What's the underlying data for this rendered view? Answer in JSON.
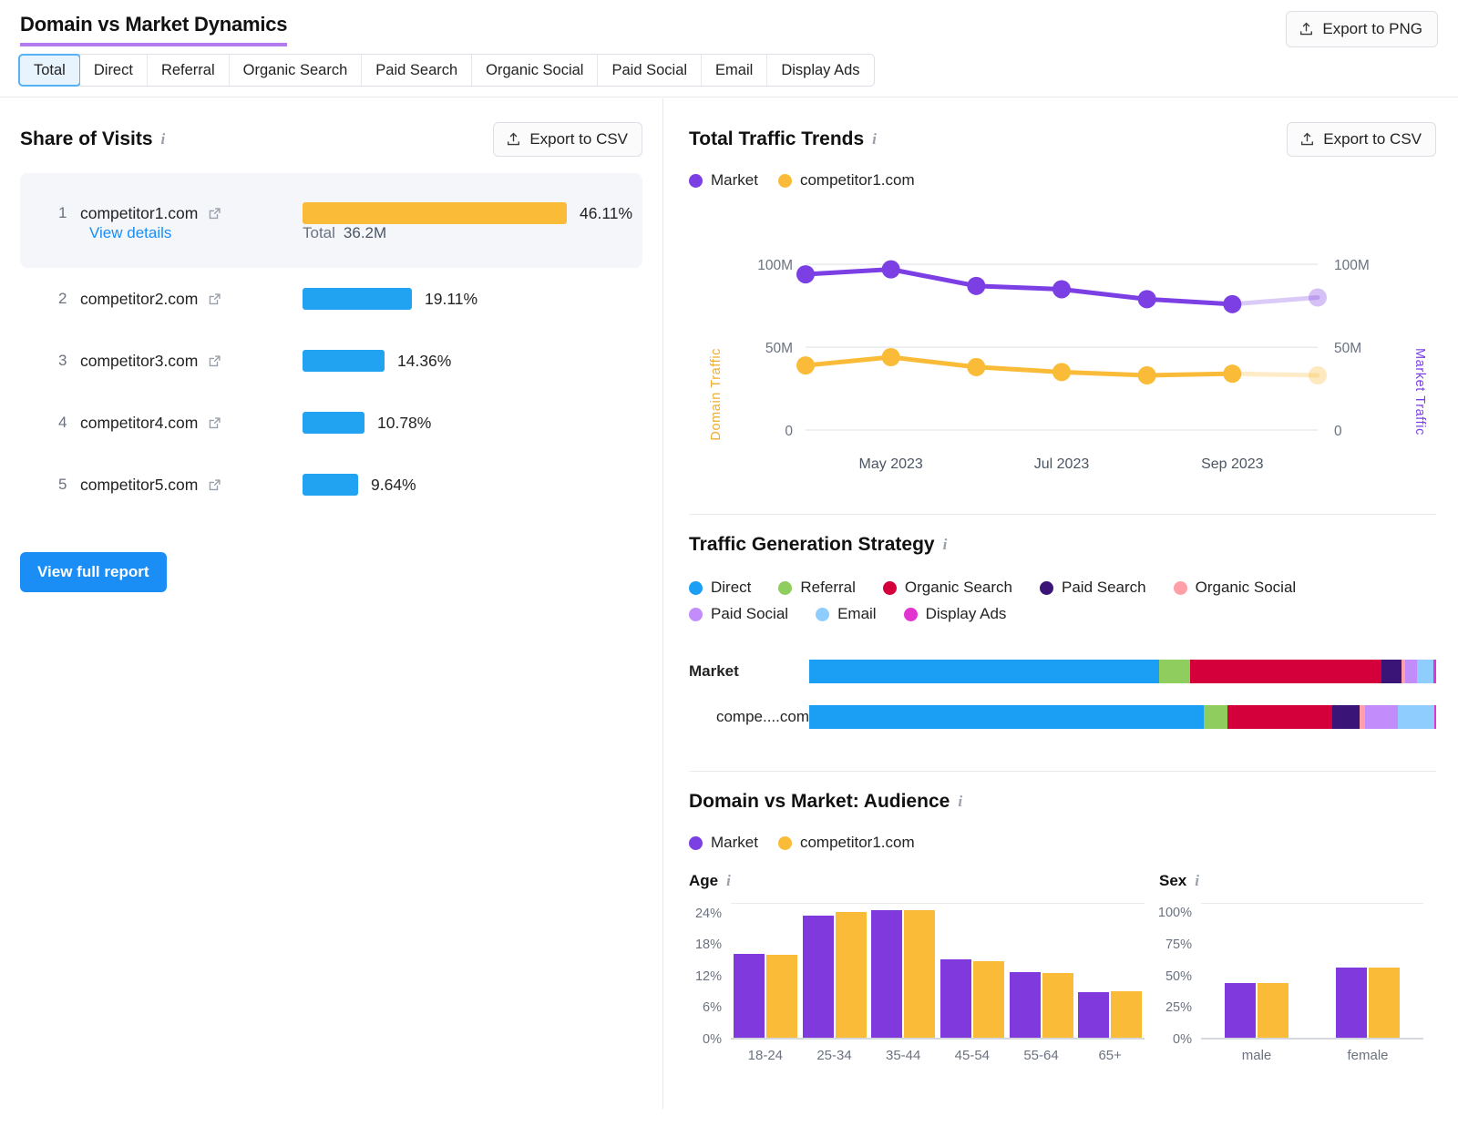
{
  "header": {
    "title": "Domain vs Market Dynamics",
    "export_png_label": "Export to PNG",
    "tabs": [
      {
        "label": "Total",
        "active": true
      },
      {
        "label": "Direct",
        "active": false
      },
      {
        "label": "Referral",
        "active": false
      },
      {
        "label": "Organic Search",
        "active": false
      },
      {
        "label": "Paid Search",
        "active": false
      },
      {
        "label": "Organic Social",
        "active": false
      },
      {
        "label": "Paid Social",
        "active": false
      },
      {
        "label": "Email",
        "active": false
      },
      {
        "label": "Display Ads",
        "active": false
      }
    ]
  },
  "share_of_visits": {
    "title": "Share of Visits",
    "export_csv_label": "Export to CSV",
    "view_details_label": "View details",
    "total_label": "Total",
    "total_value": "36.2M",
    "view_full_report_label": "View full report",
    "rows": [
      {
        "rank": "1",
        "domain": "competitor1.com",
        "pct_label": "46.11%",
        "pct": 46.11,
        "color": "#fabc38",
        "featured": true
      },
      {
        "rank": "2",
        "domain": "competitor2.com",
        "pct_label": "19.11%",
        "pct": 19.11,
        "color": "#21a3f1",
        "featured": false
      },
      {
        "rank": "3",
        "domain": "competitor3.com",
        "pct_label": "14.36%",
        "pct": 14.36,
        "color": "#21a3f1",
        "featured": false
      },
      {
        "rank": "4",
        "domain": "competitor4.com",
        "pct_label": "10.78%",
        "pct": 10.78,
        "color": "#21a3f1",
        "featured": false
      },
      {
        "rank": "5",
        "domain": "competitor5.com",
        "pct_label": "9.64%",
        "pct": 9.64,
        "color": "#21a3f1",
        "featured": false
      }
    ]
  },
  "total_traffic_trends": {
    "title": "Total Traffic Trends",
    "export_csv_label": "Export to CSV",
    "legend": [
      {
        "label": "Market",
        "color": "#7b3fe4"
      },
      {
        "label": "competitor1.com",
        "color": "#fabc38"
      }
    ],
    "left_axis_label": "Domain Traffic",
    "right_axis_label": "Market Traffic"
  },
  "traffic_generation_strategy": {
    "title": "Traffic Generation Strategy",
    "legend": [
      {
        "label": "Direct",
        "color": "#1a9ff5"
      },
      {
        "label": "Referral",
        "color": "#8ecd5e"
      },
      {
        "label": "Organic Search",
        "color": "#d4003c"
      },
      {
        "label": "Paid Search",
        "color": "#3b1478"
      },
      {
        "label": "Organic Social",
        "color": "#ff9fa8"
      },
      {
        "label": "Paid Social",
        "color": "#c28dfa"
      },
      {
        "label": "Email",
        "color": "#8fcdff"
      },
      {
        "label": "Display Ads",
        "color": "#e234d0"
      }
    ],
    "rows": [
      {
        "label": "Market",
        "bold": true
      },
      {
        "label": "compe....com",
        "bold": false
      }
    ]
  },
  "audience": {
    "title": "Domain vs Market: Audience",
    "legend": [
      {
        "label": "Market",
        "color": "#7b3fe4"
      },
      {
        "label": "competitor1.com",
        "color": "#fabc38"
      }
    ],
    "age_title": "Age",
    "sex_title": "Sex"
  },
  "icons": {
    "info": "info-icon",
    "external_link": "external-link-icon",
    "upload": "upload-icon"
  },
  "chart_data": [
    {
      "type": "line",
      "title": "Total Traffic Trends",
      "xlabel": "",
      "ylabel": "Domain Traffic",
      "y2label": "Market Traffic",
      "x": [
        "Apr 2023",
        "May 2023",
        "Jun 2023",
        "Jul 2023",
        "Aug 2023",
        "Sep 2023",
        "Oct 2023"
      ],
      "tick_labels": [
        "May 2023",
        "Jul 2023",
        "Sep 2023"
      ],
      "ylim": [
        0,
        110000000
      ],
      "yticks": [
        0,
        50000000,
        100000000
      ],
      "ytick_labels": [
        "0",
        "50M",
        "100M"
      ],
      "y2ticks": [
        0,
        50000000,
        100000000
      ],
      "y2tick_labels": [
        "0",
        "50M",
        "100M"
      ],
      "grid": true,
      "legend_position": "top-left",
      "series": [
        {
          "name": "Market",
          "color": "#7b3fe4",
          "axis": "right",
          "values": [
            94000000,
            97000000,
            87000000,
            85000000,
            79000000,
            76000000,
            80000000
          ],
          "projected_from_index": 5
        },
        {
          "name": "competitor1.com",
          "color": "#fabc38",
          "axis": "left",
          "values": [
            39000000,
            44000000,
            38000000,
            35000000,
            33000000,
            34000000,
            33000000
          ],
          "projected_from_index": 5
        }
      ]
    },
    {
      "type": "bar",
      "title": "Traffic Generation Strategy",
      "orientation": "horizontal-stacked",
      "categories": [
        "Market",
        "compe....com"
      ],
      "segments": [
        "Direct",
        "Referral",
        "Organic Search",
        "Paid Search",
        "Organic Social",
        "Paid Social",
        "Email",
        "Display Ads"
      ],
      "colors": [
        "#1a9ff5",
        "#8ecd5e",
        "#d4003c",
        "#3b1478",
        "#ff9fa8",
        "#c28dfa",
        "#8fcdff",
        "#e234d0"
      ],
      "series": [
        {
          "name": "Market",
          "values": [
            55.8,
            4.9,
            30.6,
            3.2,
            0.6,
            1.9,
            2.6,
            0.4
          ]
        },
        {
          "name": "compe....com",
          "values": [
            63.0,
            3.7,
            16.8,
            4.3,
            0.8,
            5.3,
            5.8,
            0.3
          ]
        }
      ]
    },
    {
      "type": "bar",
      "title": "Age",
      "xlabel": "",
      "ylabel": "",
      "categories": [
        "18-24",
        "25-34",
        "35-44",
        "45-54",
        "55-64",
        "65+"
      ],
      "ylim": [
        0,
        26
      ],
      "yticks": [
        0,
        6,
        12,
        18,
        24
      ],
      "ytick_labels": [
        "0%",
        "6%",
        "12%",
        "18%",
        "24%"
      ],
      "grid": true,
      "series": [
        {
          "name": "Market",
          "color": "#8039dd",
          "values": [
            16.2,
            23.6,
            24.6,
            15.1,
            12.6,
            8.8
          ]
        },
        {
          "name": "competitor1.com",
          "color": "#fabc38",
          "values": [
            16.0,
            24.3,
            24.6,
            14.7,
            12.5,
            8.9
          ]
        }
      ]
    },
    {
      "type": "bar",
      "title": "Sex",
      "xlabel": "",
      "ylabel": "",
      "categories": [
        "male",
        "female"
      ],
      "ylim": [
        0,
        108
      ],
      "yticks": [
        0,
        25,
        50,
        75,
        100
      ],
      "ytick_labels": [
        "0%",
        "25%",
        "50%",
        "75%",
        "100%"
      ],
      "grid": true,
      "series": [
        {
          "name": "Market",
          "color": "#8039dd",
          "values": [
            44.0,
            56.0
          ]
        },
        {
          "name": "competitor1.com",
          "color": "#fabc38",
          "values": [
            44.0,
            56.0
          ]
        }
      ]
    }
  ]
}
